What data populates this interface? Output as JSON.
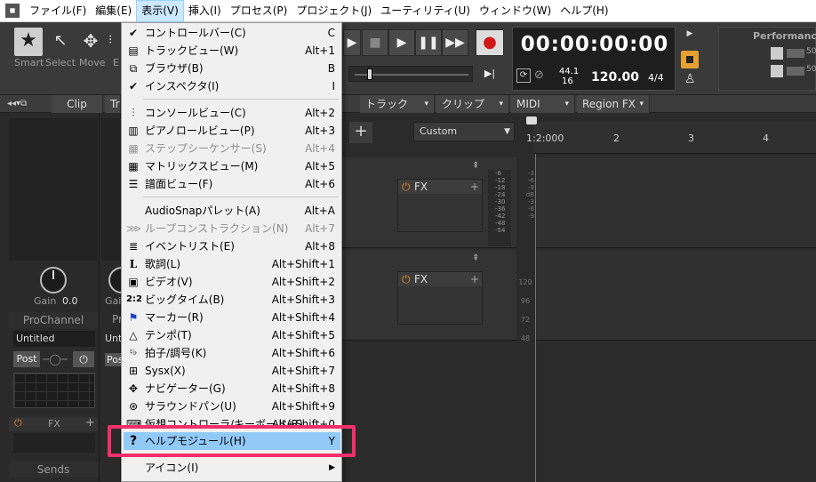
{
  "menubar": {
    "items": [
      "ファイル(F)",
      "編集(E)",
      "表示(V)",
      "挿入(I)",
      "プロセス(P)",
      "プロジェクト(J)",
      "ユーティリティ(U)",
      "ウィンドウ(W)",
      "ヘルプ(H)"
    ]
  },
  "toolbar": {
    "tools": [
      "Smart",
      "Select",
      "Move",
      "E"
    ],
    "timecode": "00:00:00:00",
    "sample_rate": "44.1",
    "bit_depth": "16",
    "tempo": "120.00",
    "meter": "4/4",
    "performance_label": "Performance",
    "perf_values": [
      "50",
      "50"
    ]
  },
  "subbar": {
    "tabs": [
      "Clip",
      "Tr",
      "トラック",
      "クリップ",
      "MIDI",
      "Region FX"
    ]
  },
  "inspector": {
    "gain_label": "Gain",
    "gain_value": "0.0",
    "gain_label2": "Gain",
    "prochannel": "ProChannel",
    "prochannel2": "Pr",
    "preset": "Untitled",
    "preset2": "Unt",
    "post": "Post",
    "post2": "Pos",
    "fx": "FX",
    "sends": "Sends"
  },
  "track": {
    "add_symbol": "+",
    "preset_select": "Custom",
    "fx1": "FX",
    "fx2": "FX",
    "ruler_marks": [
      "1:2:000",
      "2",
      "3",
      "4"
    ],
    "meter_scale": [
      "-6",
      "-12",
      "-18",
      "-24",
      "-30",
      "-36",
      "-42",
      "-48",
      "-54"
    ],
    "meter_scale_r": [
      "-3",
      "-6",
      "-9",
      "dB",
      "-3",
      "-6",
      "-9"
    ],
    "vel_scale": [
      "120",
      "96",
      "72",
      "48"
    ]
  },
  "view_menu": {
    "items": [
      {
        "icon": "check-icon",
        "label": "コントロールバー(C)",
        "shortcut": "C"
      },
      {
        "icon": "track-view-icon",
        "label": "トラックビュー(W)",
        "shortcut": "Alt+1"
      },
      {
        "icon": "browser-icon",
        "label": "ブラウザ(B)",
        "shortcut": "B"
      },
      {
        "icon": "check-icon",
        "label": "インスペクタ(I)",
        "shortcut": "I"
      },
      {
        "icon": "console-icon",
        "label": "コンソールビュー(C)",
        "shortcut": "Alt+2"
      },
      {
        "icon": "piano-roll-icon",
        "label": "ピアノロールビュー(P)",
        "shortcut": "Alt+3"
      },
      {
        "icon": "step-sequencer-icon",
        "label": "ステップシーケンサー(S)",
        "shortcut": "Alt+4"
      },
      {
        "icon": "matrix-icon",
        "label": "マトリックスビュー(M)",
        "shortcut": "Alt+5"
      },
      {
        "icon": "staff-icon",
        "label": "譜面ビュー(F)",
        "shortcut": "Alt+6"
      },
      {
        "icon": "",
        "label": "AudioSnapパレット(A)",
        "shortcut": "Alt+A"
      },
      {
        "icon": "loop-construction-icon",
        "label": "ループコンストラクション(N)",
        "shortcut": "Alt+7"
      },
      {
        "icon": "event-list-icon",
        "label": "イベントリスト(E)",
        "shortcut": "Alt+8"
      },
      {
        "icon": "lyrics-icon",
        "label": "歌詞(L)",
        "shortcut": "Alt+Shift+1"
      },
      {
        "icon": "video-icon",
        "label": "ビデオ(V)",
        "shortcut": "Alt+Shift+2"
      },
      {
        "icon": "big-time-icon",
        "label": "ビッグタイム(B)",
        "shortcut": "Alt+Shift+3"
      },
      {
        "icon": "marker-icon",
        "label": "マーカー(R)",
        "shortcut": "Alt+Shift+4"
      },
      {
        "icon": "tempo-icon",
        "label": "テンポ(T)",
        "shortcut": "Alt+Shift+5"
      },
      {
        "icon": "meter-key-icon",
        "label": "拍子/調号(K)",
        "shortcut": "Alt+Shift+6"
      },
      {
        "icon": "sysx-icon",
        "label": "Sysx(X)",
        "shortcut": "Alt+Shift+7"
      },
      {
        "icon": "navigator-icon",
        "label": "ナビゲーター(G)",
        "shortcut": "Alt+Shift+8"
      },
      {
        "icon": "surround-pan-icon",
        "label": "サラウンドパン(U)",
        "shortcut": "Alt+Shift+9"
      },
      {
        "icon": "virtual-keyboard-icon",
        "label": "仮想コントローラ/キーボード(R)",
        "shortcut": "Alt+Shift+0"
      },
      {
        "icon": "help-icon",
        "label": "ヘルプモジュール(H)",
        "shortcut": "Y"
      },
      {
        "icon": "",
        "label": "アイコン(I)",
        "shortcut": ""
      }
    ]
  }
}
